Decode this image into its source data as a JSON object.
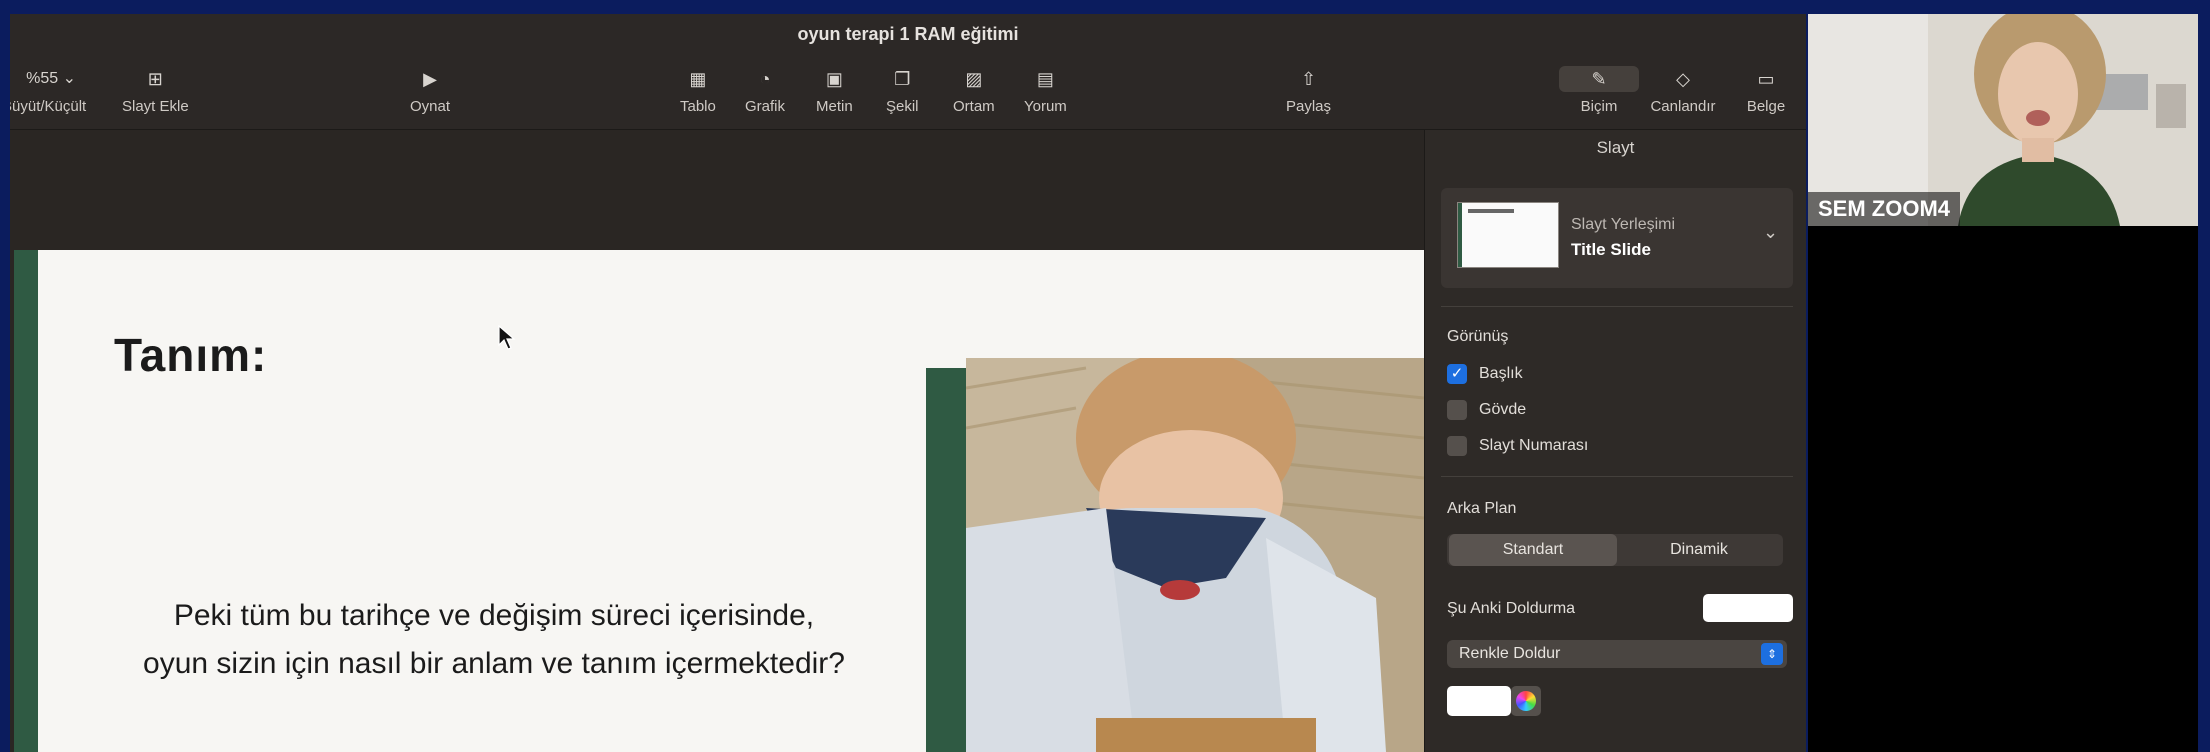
{
  "window": {
    "title": "oyun terapi 1 RAM eğitimi"
  },
  "toolbar": {
    "zoom_value": "%55",
    "zoom_label": "Büyüt/Küçült",
    "add_slide": "Slayt Ekle",
    "play": "Oynat",
    "table": "Tablo",
    "chart": "Grafik",
    "text": "Metin",
    "shape": "Şekil",
    "media": "Ortam",
    "comment": "Yorum",
    "share": "Paylaş",
    "format": "Biçim",
    "animate": "Canlandır",
    "document": "Belge"
  },
  "slide": {
    "title": "Tanım:",
    "body_line1": "Peki tüm bu tarihçe ve değişim süreci içerisinde,",
    "body_line2": "oyun sizin için nasıl bir anlam ve tanım içermektedir?"
  },
  "inspector": {
    "header": "Slayt",
    "layout_sub": "Slayt Yerleşimi",
    "layout_name": "Title Slide",
    "appearance": "Görünüş",
    "cb_title": "Başlık",
    "cb_body": "Gövde",
    "cb_number": "Slayt Numarası",
    "background": "Arka Plan",
    "seg_standard": "Standart",
    "seg_dynamic": "Dinamik",
    "current_fill": "Şu Anki Doldurma",
    "fill_type": "Renkle Doldur"
  },
  "checkboxes": {
    "title": true,
    "body": false,
    "number": false
  },
  "video": {
    "participant": "SEM ZOOM4"
  },
  "colors": {
    "accent": "#1d6fe0",
    "slide_green": "#2f5a43",
    "frame_blue": "#0b1c5e"
  }
}
